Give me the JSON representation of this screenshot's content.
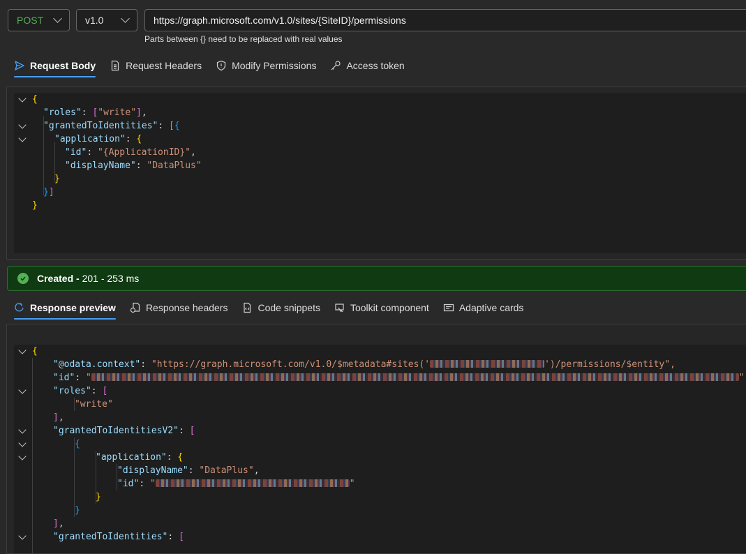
{
  "request": {
    "method": "POST",
    "version": "v1.0",
    "url": "https://graph.microsoft.com/v1.0/sites/{SiteID}/permissions",
    "hint": "Parts between {} need to be replaced with real values"
  },
  "request_tabs": [
    {
      "label": "Request Body",
      "icon": "send-icon",
      "active": true
    },
    {
      "label": "Request Headers",
      "icon": "document-icon",
      "active": false
    },
    {
      "label": "Modify Permissions",
      "icon": "shield-icon",
      "active": false
    },
    {
      "label": "Access token",
      "icon": "key-icon",
      "active": false
    }
  ],
  "request_body": {
    "roles_key": "\"roles\"",
    "roles_value": "\"write\"",
    "granted_key": "\"grantedToIdentities\"",
    "application_key": "\"application\"",
    "id_key": "\"id\"",
    "id_value": "\"{ApplicationID}\"",
    "display_name_key": "\"displayName\"",
    "display_name_value": "\"DataPlus\""
  },
  "status": {
    "label": "Created -",
    "detail": "201 - 253 ms",
    "color": "#54b054"
  },
  "response_tabs": [
    {
      "label": "Response preview",
      "icon": "preview-icon",
      "active": true
    },
    {
      "label": "Response headers",
      "icon": "headers-icon",
      "active": false
    },
    {
      "label": "Code snippets",
      "icon": "code-icon",
      "active": false
    },
    {
      "label": "Toolkit component",
      "icon": "toolkit-icon",
      "active": false
    },
    {
      "label": "Adaptive cards",
      "icon": "card-icon",
      "active": false
    }
  ],
  "response_body": {
    "context_key": "\"@odata.context\"",
    "context_prefix": "\"https://graph.microsoft.com/v1.0/$metadata#sites('",
    "context_suffix": "')/permissions/$entity\",",
    "id_key": "\"id\"",
    "roles_key": "\"roles\"",
    "roles_item": "\"write\"",
    "granted_v2_key": "\"grantedToIdentitiesV2\"",
    "application_key": "\"application\"",
    "display_name_key": "\"displayName\"",
    "display_name_value": "\"DataPlus\"",
    "app_id_key": "\"id\"",
    "granted_key": "\"grantedToIdentities\""
  }
}
